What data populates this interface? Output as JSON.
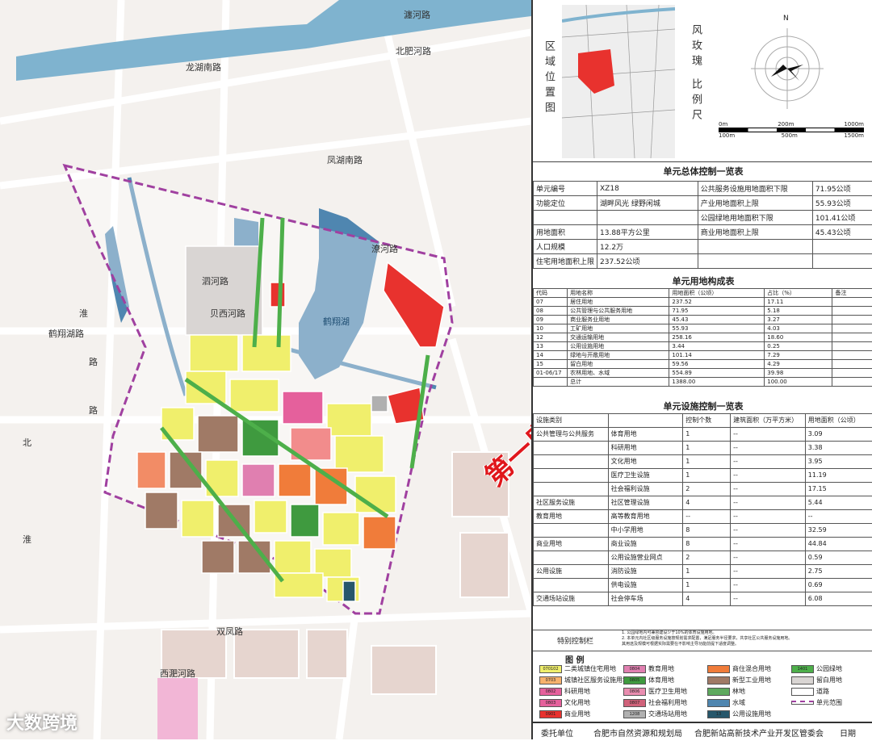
{
  "map": {
    "road_labels": [
      "瀍河路",
      "北肥河路",
      "龙湖南路",
      "凤湖南路",
      "鹤翔湖路",
      "双凤路",
      "西淝河路",
      "潦河路",
      "泗河路",
      "贝西河路",
      "淮",
      "北",
      "淮",
      "路",
      "路"
    ],
    "lake_label": "鹤翔湖"
  },
  "watermark": "第一房研究院",
  "logo": "大数跨境",
  "location": {
    "title_left": "区域位置图",
    "title_right": "风玫瑰 比例尺",
    "north": "N",
    "scale_top": [
      "0m",
      "200m",
      "1000m"
    ],
    "scale_bottom": [
      "100m",
      "500m",
      "1500m"
    ]
  },
  "overview": {
    "title": "单元总体控制一览表",
    "rows": [
      [
        "单元编号",
        "XZ18",
        "公共服务设施用地面积下限",
        "71.95公顷"
      ],
      [
        "功能定位",
        "湖畔风光 绿野闲城",
        "产业用地面积上限",
        "55.93公顷"
      ],
      [
        "",
        "",
        "公园绿地用地面积下限",
        "101.41公顷"
      ],
      [
        "用地面积",
        "13.88平方公里",
        "商业用地面积上限",
        "45.43公顷"
      ],
      [
        "人口规模",
        "12.2万",
        "",
        ""
      ],
      [
        "住宅用地面积上限",
        "237.52公顷",
        "",
        ""
      ]
    ]
  },
  "composition": {
    "title": "单元用地构成表",
    "headers": [
      "代码",
      "用地名称",
      "用地面积（公顷）",
      "占比（%）",
      "备注"
    ],
    "rows": [
      [
        "07",
        "居住用地",
        "237.52",
        "17.11",
        ""
      ],
      [
        "08",
        "公共管理与公共服务用地",
        "71.95",
        "5.18",
        ""
      ],
      [
        "09",
        "商业服务业用地",
        "45.43",
        "3.27",
        ""
      ],
      [
        "10",
        "工矿用地",
        "55.93",
        "4.03",
        ""
      ],
      [
        "12",
        "交通运输用地",
        "258.16",
        "18.60",
        ""
      ],
      [
        "13",
        "公用设施用地",
        "3.44",
        "0.25",
        ""
      ],
      [
        "14",
        "绿地与开敞用地",
        "101.14",
        "7.29",
        ""
      ],
      [
        "15",
        "留白用地",
        "59.56",
        "4.29",
        ""
      ],
      [
        "01-06/17",
        "农林用地、水域",
        "554.89",
        "39.98",
        ""
      ],
      [
        "",
        "总计",
        "1388.00",
        "100.00",
        ""
      ]
    ]
  },
  "facilities": {
    "title": "单元设施控制一览表",
    "headers": [
      "设施类别",
      "",
      "控制个数",
      "建筑面积（万平方米）",
      "用地面积（公顷）"
    ],
    "rows": [
      [
        "公共管理与公共服务",
        "体育用地",
        "1",
        "--",
        "3.09"
      ],
      [
        "",
        "科研用地",
        "1",
        "--",
        "3.38"
      ],
      [
        "",
        "文化用地",
        "1",
        "--",
        "3.95"
      ],
      [
        "",
        "医疗卫生设施",
        "1",
        "--",
        "11.19"
      ],
      [
        "",
        "社会福利设施",
        "2",
        "--",
        "17.15"
      ],
      [
        "社区服务设施",
        "社区管理设施",
        "4",
        "--",
        "5.44"
      ],
      [
        "教育用地",
        "高等教育用地",
        "--",
        "--",
        "--"
      ],
      [
        "",
        "中小学用地",
        "8",
        "--",
        "32.59"
      ],
      [
        "商业用地",
        "商业设施",
        "8",
        "--",
        "44.84"
      ],
      [
        "",
        "公用设施营业网点",
        "2",
        "--",
        "0.59"
      ],
      [
        "公用设施",
        "消防设施",
        "1",
        "--",
        "2.75"
      ],
      [
        "",
        "供电设施",
        "1",
        "--",
        "0.69"
      ],
      [
        "交通场站设施",
        "社会停车场",
        "4",
        "--",
        "6.08"
      ]
    ],
    "special_label": "特别控制栏",
    "notes": [
      "1. 公园绿地内可兼容建设少于10%的体育设施用地。",
      "2. 本单元内社区级服务设施按规划需求配置，满足服务半径要求，共享社区公共服务设施用地。",
      "其用途及规模可根据实际需要在不影响主导功能前提下适度调整。"
    ]
  },
  "legend": {
    "title": "图     例",
    "items": [
      {
        "label": "二类城镇住宅用地",
        "color": "#f0ef6c",
        "tag": "070102"
      },
      {
        "label": "城镇社区服务设施用地",
        "color": "#f7b26d",
        "tag": "0703"
      },
      {
        "label": "科研用地",
        "color": "#e5609c",
        "tag": "0802"
      },
      {
        "label": "文化用地",
        "color": "#e5609c",
        "tag": "0803"
      },
      {
        "label": "商业用地",
        "color": "#e8322e",
        "tag": "0901"
      },
      {
        "label": "教育用地",
        "color": "#e07fb0",
        "tag": "0804"
      },
      {
        "label": "体育用地",
        "color": "#3f9a3f",
        "tag": "0805"
      },
      {
        "label": "医疗卫生用地",
        "color": "#e98db0",
        "tag": "0806"
      },
      {
        "label": "社会福利用地",
        "color": "#d0627a",
        "tag": "0807"
      },
      {
        "label": "交通场站用地",
        "color": "#b0b0b0",
        "tag": "1208"
      },
      {
        "label": "商住混合用地",
        "color": "#f07c3a",
        "tag": ""
      },
      {
        "label": "新型工业用地",
        "color": "#a07a66",
        "tag": ""
      },
      {
        "label": "林地",
        "color": "#5ea95e",
        "tag": ""
      },
      {
        "label": "水域",
        "color": "#4f86b0",
        "tag": ""
      },
      {
        "label": "公用设施用地",
        "color": "#27576b",
        "tag": "13"
      },
      {
        "label": "公园绿地",
        "color": "#4daf4a",
        "tag": "1401"
      },
      {
        "label": "留白用地",
        "color": "#d9d5d3",
        "tag": ""
      },
      {
        "label": "道路",
        "color": "#ffffff",
        "tag": ""
      },
      {
        "label": "单元范围",
        "color": "#a040a0",
        "tag": ""
      }
    ]
  },
  "footer": {
    "label": "委托单位",
    "org1": "合肥市自然资源和规划局",
    "org2": "合肥新站高新技术产业开发区管委会",
    "date_label": "日期"
  }
}
